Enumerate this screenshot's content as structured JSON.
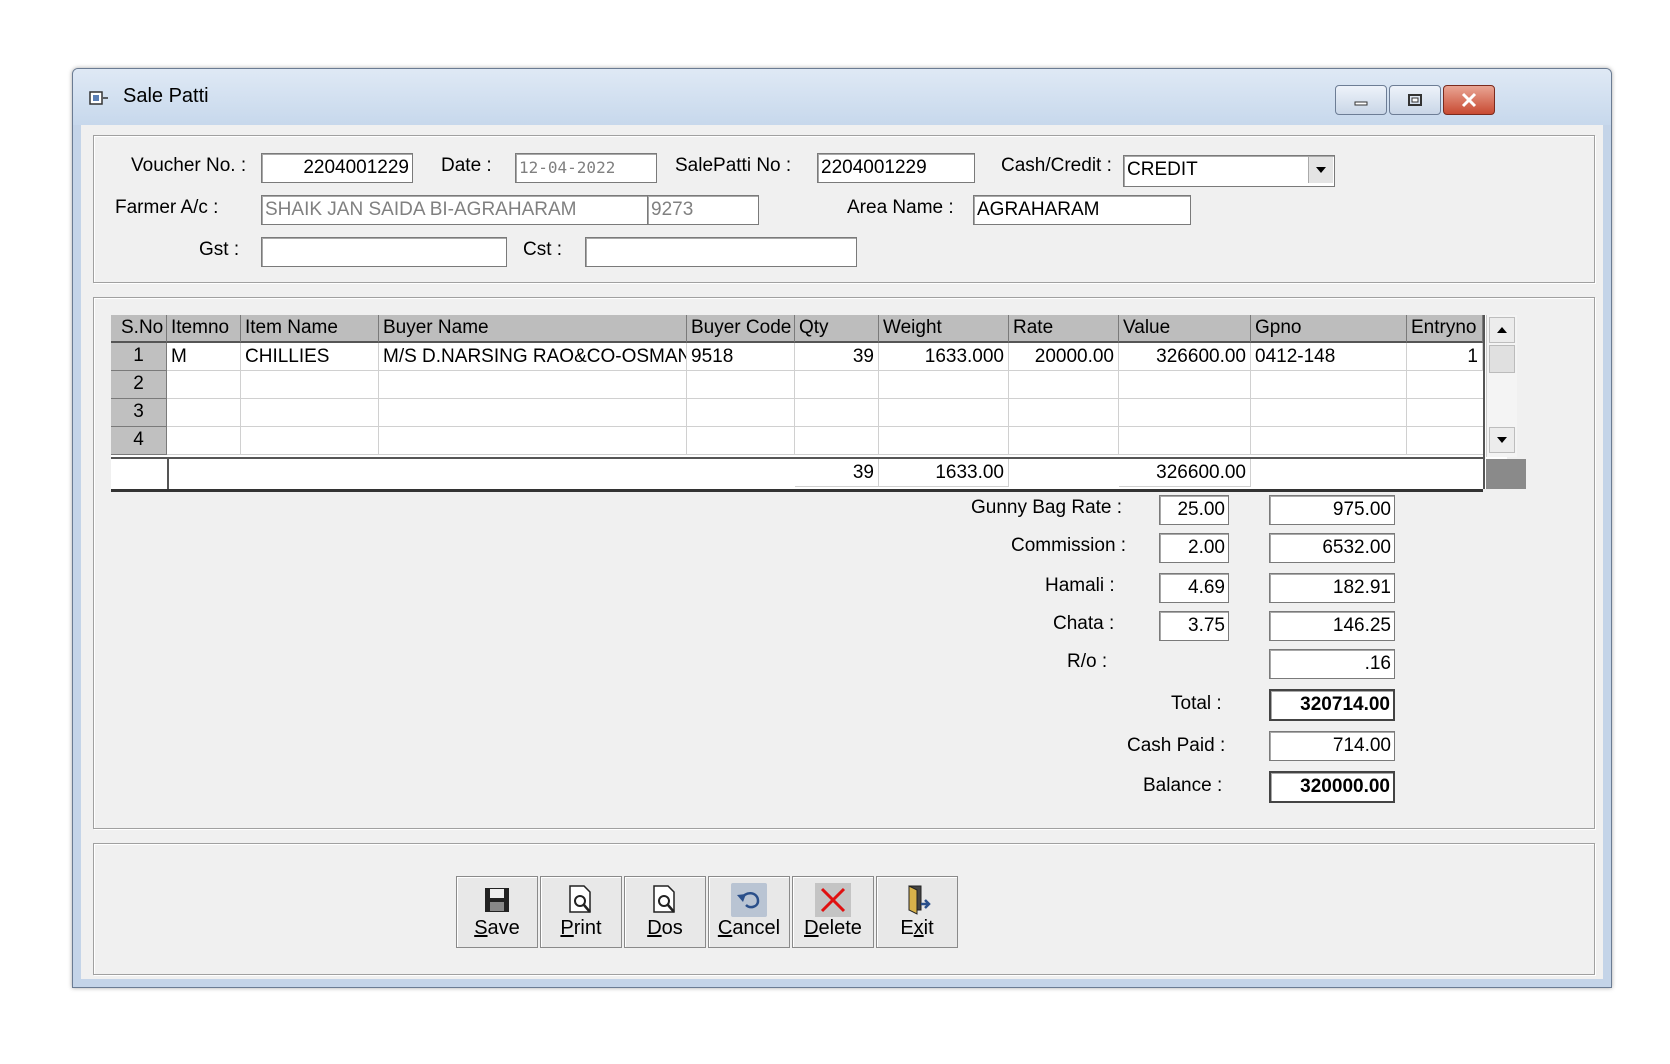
{
  "window": {
    "title": "Sale Patti"
  },
  "header": {
    "voucher_label": "Voucher No. :",
    "voucher_value": "2204001229",
    "date_label": "Date :",
    "date_value": "12-04-2022",
    "salepatti_label": "SalePatti No :",
    "salepatti_value": "2204001229",
    "cash_credit_label": "Cash/Credit :",
    "cash_credit_value": "CREDIT",
    "farmer_label": "Farmer A/c :",
    "farmer_name": "SHAIK JAN SAIDA BI-AGRAHARAM",
    "farmer_code": "9273",
    "area_label": "Area Name :",
    "area_value": "AGRAHARAM",
    "gst_label": "Gst :",
    "gst_value": "",
    "cst_label": "Cst :",
    "cst_value": ""
  },
  "grid": {
    "columns": [
      "S.No",
      "Itemno",
      "Item Name",
      "Buyer Name",
      "Buyer Code",
      "Qty",
      "Weight",
      "Rate",
      "Value",
      "Gpno",
      "Entryno"
    ],
    "rows": [
      {
        "sno": "1",
        "itemno": "M",
        "item_name": "CHILLIES",
        "buyer_name": "M/S D.NARSING RAO&CO-OSMANGUNJ",
        "buyer_code": "9518",
        "qty": "39",
        "weight": "1633.000",
        "rate": "20000.00",
        "value": "326600.00",
        "gpno": "0412-148",
        "entryno": "1"
      },
      {
        "sno": "2"
      },
      {
        "sno": "3"
      },
      {
        "sno": "4"
      }
    ],
    "totals": {
      "qty": "39",
      "weight": "1633.00",
      "value": "326600.00"
    }
  },
  "charges": {
    "gunny_label": "Gunny Bag Rate :",
    "gunny_rate": "25.00",
    "gunny_amount": "975.00",
    "commission_label": "Commission :",
    "commission_rate": "2.00",
    "commission_amount": "6532.00",
    "hamali_label": "Hamali :",
    "hamali_rate": "4.69",
    "hamali_amount": "182.91",
    "chata_label": "Chata :",
    "chata_rate": "3.75",
    "chata_amount": "146.25",
    "ro_label": "R/o :",
    "ro_amount": ".16",
    "total_label": "Total :",
    "total_amount": "320714.00",
    "cash_paid_label": "Cash Paid :",
    "cash_paid_amount": "714.00",
    "balance_label": "Balance :",
    "balance_amount": "320000.00"
  },
  "toolbar": {
    "save": {
      "pre": "",
      "key": "S",
      "post": "ave"
    },
    "print": {
      "pre": "",
      "key": "P",
      "post": "rint"
    },
    "dos": {
      "pre": "",
      "key": "D",
      "post": "os"
    },
    "cancel": {
      "pre": "",
      "key": "C",
      "post": "ancel"
    },
    "delete": {
      "pre": "",
      "key": "D",
      "post": "elete"
    },
    "exit": {
      "pre": "E",
      "key": "x",
      "post": "it"
    }
  }
}
